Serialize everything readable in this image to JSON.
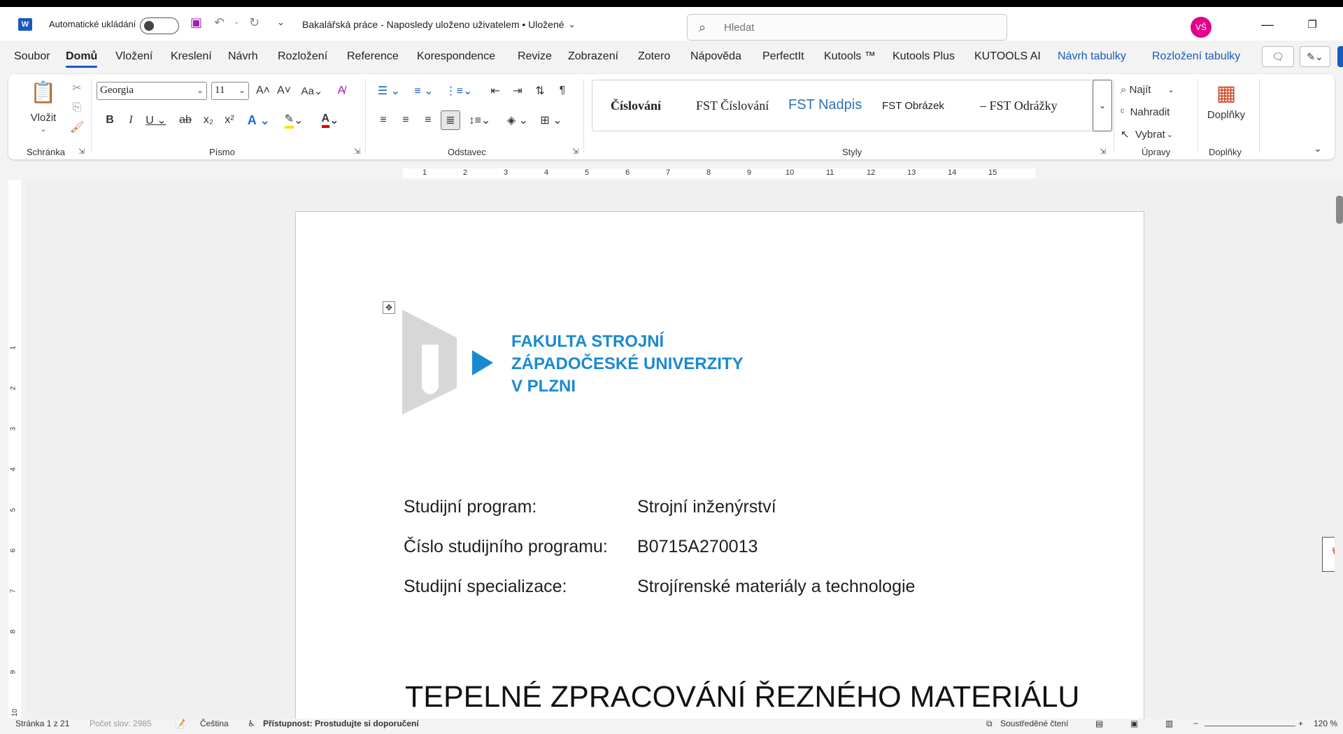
{
  "titlebar": {
    "autosave_label": "Automatické ukládání",
    "document_title": "Bakalářská práce  -  Naposledy uloženo uživatelem • Uložené",
    "search_placeholder": "Hledat",
    "user_initials": "VŠ"
  },
  "menu": {
    "tabs": [
      "Soubor",
      "Domů",
      "Vložení",
      "Kreslení",
      "Návrh",
      "Rozložení",
      "Reference",
      "Korespondence",
      "Revize",
      "Zobrazení",
      "Zotero",
      "Nápověda",
      "PerfectIt",
      "Kutools ™",
      "Kutools Plus",
      "KUTOOLS AI",
      "Návrh tabulky",
      "Rozložení tabulky"
    ],
    "active_tab": "Domů"
  },
  "ribbon": {
    "clipboard": {
      "paste_label": "Vložit",
      "group_label": "Schránka"
    },
    "font": {
      "font_name": "Georgia",
      "font_size": "11",
      "group_label": "Písmo",
      "case_label": "Aa"
    },
    "paragraph": {
      "group_label": "Odstavec"
    },
    "styles": {
      "group_label": "Styly",
      "items": [
        "Číslování",
        "FST Číslování",
        "FST Nadpis",
        "FST Obrázek",
        "FST Odrážky"
      ]
    },
    "editing": {
      "find_label": "Najít",
      "replace_label": "Nahradit",
      "select_label": "Vybrat",
      "group_label": "Úpravy"
    },
    "addins": {
      "label": "Doplňky",
      "group_label": "Doplňky"
    }
  },
  "ruler": {
    "h_numbers": [
      "1",
      "2",
      "3",
      "4",
      "5",
      "6",
      "7",
      "8",
      "9",
      "10",
      "11",
      "12",
      "13",
      "14",
      "15"
    ],
    "v_numbers": [
      "1",
      "2",
      "3",
      "4",
      "5",
      "6",
      "7",
      "8",
      "9",
      "10"
    ]
  },
  "document": {
    "faculty_lines": [
      "FAKULTA STROJNÍ",
      "ZÁPADOČESKÉ UNIVERZITY",
      "V PLZNI"
    ],
    "fields": [
      {
        "label": "Studijní program:",
        "value": "Strojní inženýrství"
      },
      {
        "label": "Číslo studijního programu:",
        "value": "B0715A270013"
      },
      {
        "label": "Studijní specializace:",
        "value": "Strojírenské materiály a technologie"
      }
    ],
    "thesis_title": "TEPELNÉ ZPRACOVÁNÍ ŘEZNÉHO MATERIÁLU"
  },
  "statusbar": {
    "page": "Stránka 1 z 21",
    "words": "Počet slov: 2985",
    "language": "Čeština",
    "accessibility": "Přístupnost: Prostudujte si doporučení",
    "focus": "Soustředěné čtení",
    "zoom": "120 %"
  },
  "colors": {
    "accent": "#185abd",
    "faculty_blue": "#1a8ad0",
    "avatar": "#e3008c"
  }
}
